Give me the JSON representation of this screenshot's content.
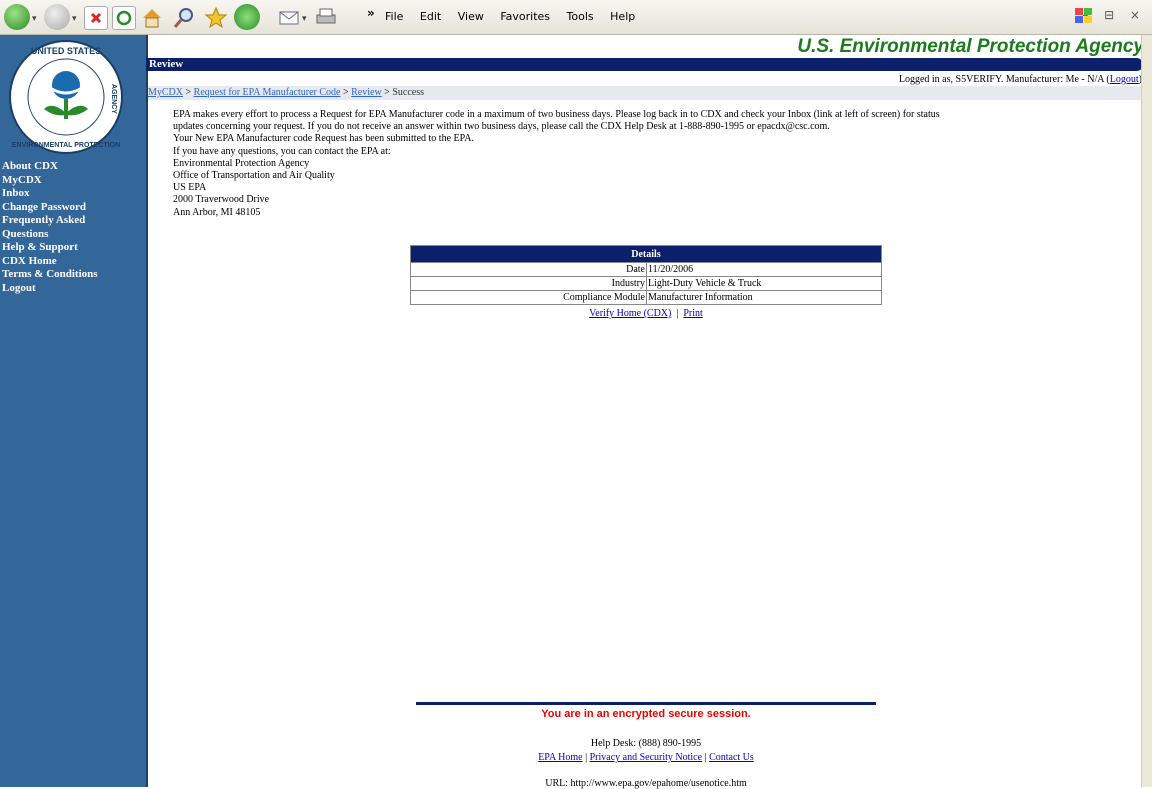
{
  "toolbar": {
    "menu": [
      "File",
      "Edit",
      "View",
      "Favorites",
      "Tools",
      "Help"
    ],
    "chevron": "»",
    "window_controls": "– ⊟ ×"
  },
  "sidebar": {
    "logo_text": [
      "UNITED STATES",
      "ENVIRONMENTAL PROTECTION",
      "AGENCY"
    ],
    "nav": [
      "About CDX",
      "MyCDX",
      "Inbox",
      "Change Password",
      "Frequently Asked",
      "Questions",
      "Help & Support",
      "CDX Home",
      "Terms & Conditions",
      "Logout"
    ]
  },
  "header": {
    "agency": "U.S. Environmental Protection Agency",
    "section": "Review",
    "login_text": "Logged in as, S5VERIFY. Manufacturer: Me  - N/A (",
    "logout_link": "Logout",
    "login_close": ")"
  },
  "breadcrumb": {
    "items": [
      "MyCDX",
      "Request for EPA Manufacturer Code",
      "Review"
    ],
    "current": "Success",
    "sep": ">"
  },
  "content": {
    "lines": [
      "EPA makes every effort to process a Request for EPA Manufacturer code in a maximum of two business days. Please log back in to CDX and check your Inbox (link at left of screen) for status",
      "updates concerning your request. If you do not receive an answer within two business days, please call the CDX Help Desk at 1-888-890-1995 or epacdx@csc.com.",
      "Your New EPA Manufacturer code Request has been submitted to the EPA.",
      "If you have any questions, you can contact the EPA at:",
      "Environmental Protection Agency",
      "Office of Transportation and Air Quality",
      "US EPA",
      "2000 Traverwood Drive",
      "Ann Arbor, MI 48105"
    ]
  },
  "details": {
    "title": "Details",
    "rows": [
      {
        "label": "Date",
        "value": "11/20/2006"
      },
      {
        "label": "Industry",
        "value": "Light-Duty Vehicle & Truck"
      },
      {
        "label": "Compliance Module",
        "value": "Manufacturer Information"
      }
    ],
    "link1": "Verify Home (CDX)",
    "sep": "|",
    "link2": "Print"
  },
  "footer": {
    "secure": "You are in an encrypted secure session.",
    "helpdesk": "Help Desk: (888) 890-1995",
    "link1": "EPA Home",
    "link2": "Privacy and Security Notice",
    "link3": "Contact Us",
    "sep": "|",
    "url": "URL: http://www.epa.gov/epahome/usenotice.htm"
  },
  "colors": {
    "sidebar": "#336699",
    "banner": "#0b1f6a",
    "agency": "#1e7a1e",
    "secure": "#ee0000"
  }
}
